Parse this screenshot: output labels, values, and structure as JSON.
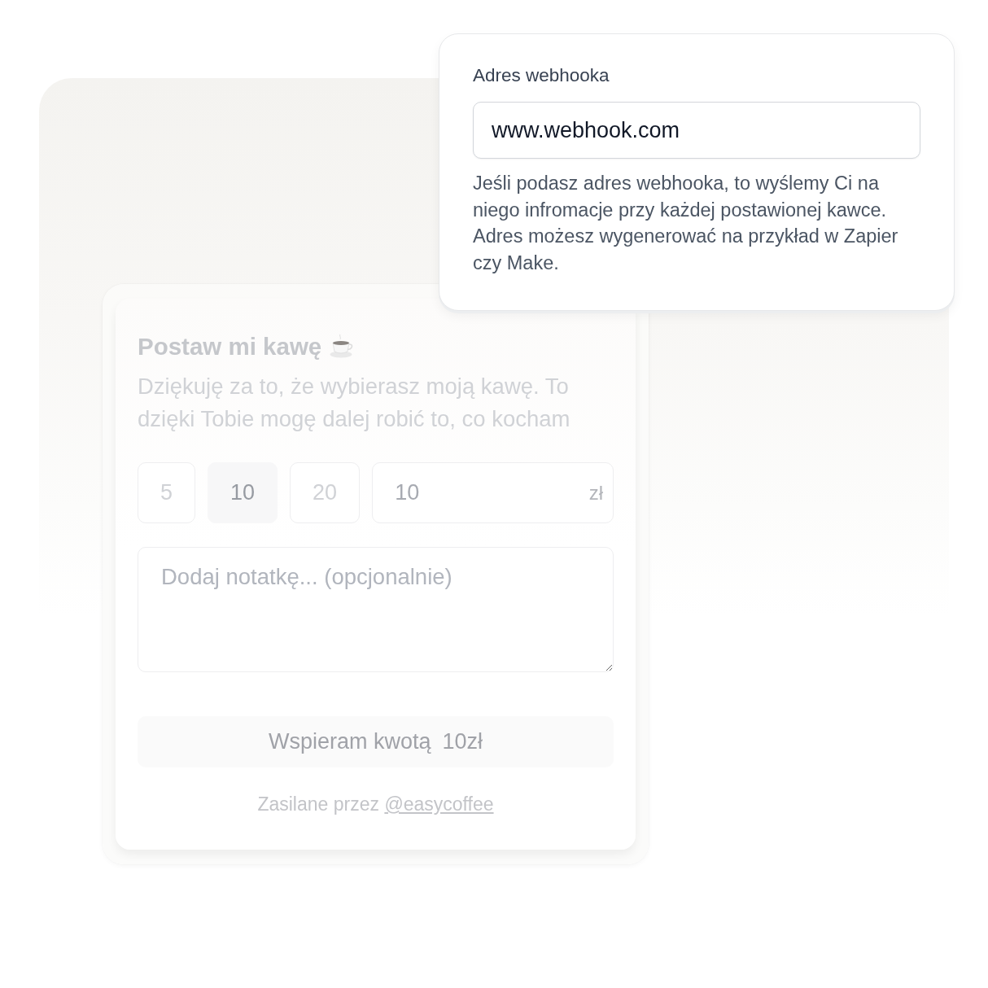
{
  "webhook_popup": {
    "label": "Adres webhooka",
    "value": "www.webhook.com",
    "help_text": "Jeśli podasz adres webhooka, to wyślemy Ci na niego infromacje przy każdej postawionej kawce. Adres możesz wygenerować na przykład w Zapier czy Make."
  },
  "form": {
    "title": "Postaw mi kawę",
    "description": "Dziękuję za to, że wybierasz moją kawę. To dzięki Tobie mogę dalej robić to, co kocham",
    "amounts": [
      {
        "label": "5",
        "selected": false
      },
      {
        "label": "10",
        "selected": true
      },
      {
        "label": "20",
        "selected": false
      }
    ],
    "custom_amount": {
      "value": "10",
      "suffix": "zł"
    },
    "note": {
      "placeholder": "Dodaj notatkę... (opcjonalnie)"
    },
    "submit_button": {
      "label": "Wspieram kwotą",
      "amount": "10zł"
    },
    "footer": {
      "text": "Zasilane przez",
      "link": "@easycoffee"
    }
  }
}
